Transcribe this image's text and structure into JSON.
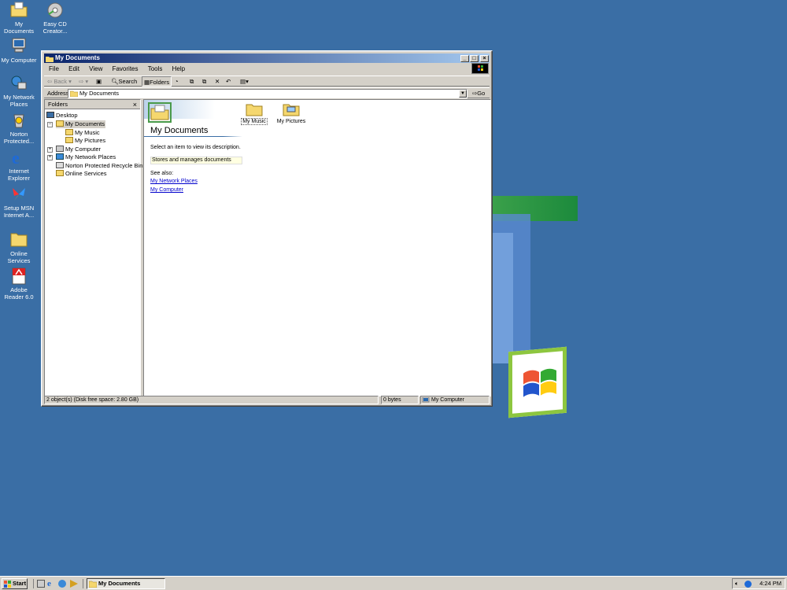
{
  "desktop": {
    "icons": [
      {
        "label": "My Documents"
      },
      {
        "label": "Easy CD Creator..."
      },
      {
        "label": "My Computer"
      },
      {
        "label": "My Network Places"
      },
      {
        "label": "Norton Protected..."
      },
      {
        "label": "Internet Explorer"
      },
      {
        "label": "Setup MSN Internet A..."
      },
      {
        "label": "Online Services"
      },
      {
        "label": "Adobe Reader 6.0"
      }
    ]
  },
  "window": {
    "title": "My Documents",
    "menu": [
      "File",
      "Edit",
      "View",
      "Favorites",
      "Tools",
      "Help"
    ],
    "toolbar": {
      "back": "Back",
      "search": "Search",
      "folders": "Folders"
    },
    "address": {
      "label": "Address",
      "value": "My Documents",
      "go": "Go"
    },
    "folders_pane": {
      "title": "Folders",
      "close": "×",
      "tree": [
        "Desktop",
        "My Documents",
        "My Music",
        "My Pictures",
        "My Computer",
        "My Network Places",
        "Norton Protected Recycle Bin",
        "Online Services"
      ]
    },
    "content": {
      "heading": "My Documents",
      "description": "Select an item to view its description.",
      "tooltip": "Stores and manages documents",
      "see_also": "See also:",
      "links": [
        "My Network Places",
        "My Computer"
      ],
      "items": [
        "My Music",
        "My Pictures"
      ]
    },
    "statusbar": {
      "objects": "2 object(s) (Disk free space: 2.80 GB)",
      "size": "0 bytes",
      "location": "My Computer"
    }
  },
  "taskbar": {
    "start": "Start",
    "task": "My Documents",
    "clock": "4:24 PM"
  }
}
